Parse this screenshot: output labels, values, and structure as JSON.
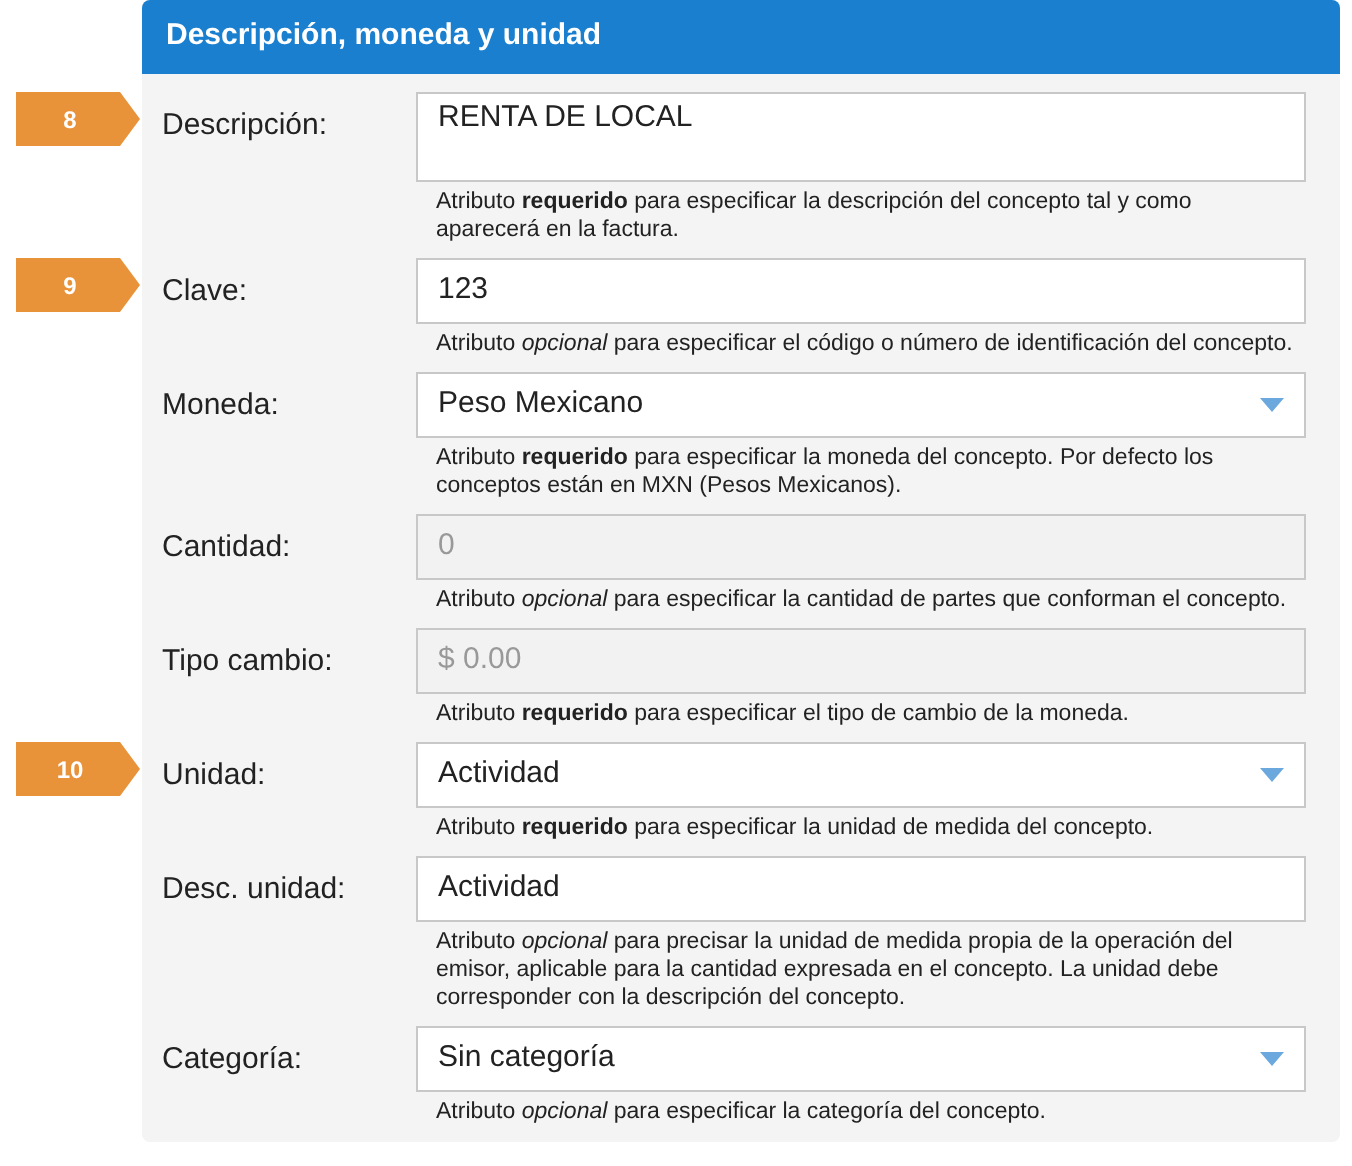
{
  "panel": {
    "title": "Descripción, moneda y unidad"
  },
  "fields": [
    {
      "badge": "8",
      "label": "Descripción:",
      "kind": "textarea",
      "value": "RENTA DE LOCAL",
      "help": "Atributo **requerido** para especificar la descripción del concepto tal y como aparecerá en la factura."
    },
    {
      "badge": "9",
      "label": "Clave:",
      "kind": "text",
      "value": "123",
      "help": "Atributo *opcional* para especificar el código o número de identificación del concepto."
    },
    {
      "label": "Moneda:",
      "kind": "select",
      "value": "Peso Mexicano",
      "help": "Atributo **requerido** para especificar la moneda del concepto. Por defecto los conceptos están en MXN (Pesos Mexicanos)."
    },
    {
      "label": "Cantidad:",
      "kind": "disabled",
      "value": "0",
      "help": "Atributo *opcional* para especificar la cantidad de partes que conforman el concepto."
    },
    {
      "label": "Tipo cambio:",
      "kind": "disabled",
      "value": "$ 0.00",
      "help": "Atributo **requerido** para especificar el tipo de cambio de la moneda."
    },
    {
      "badge": "10",
      "label": "Unidad:",
      "kind": "select",
      "value": "Actividad",
      "help": "Atributo **requerido** para especificar la unidad de medida del concepto."
    },
    {
      "label": "Desc. unidad:",
      "kind": "text",
      "value": "Actividad",
      "help": "Atributo *opcional* para precisar la unidad de medida propia de la operación del emisor, aplicable para la cantidad expresada en el concepto. La unidad debe corresponder con la descripción del concepto."
    },
    {
      "label": "Categoría:",
      "kind": "select",
      "value": "Sin categoría",
      "help": "Atributo *opcional* para especificar la categoría del concepto."
    }
  ]
}
